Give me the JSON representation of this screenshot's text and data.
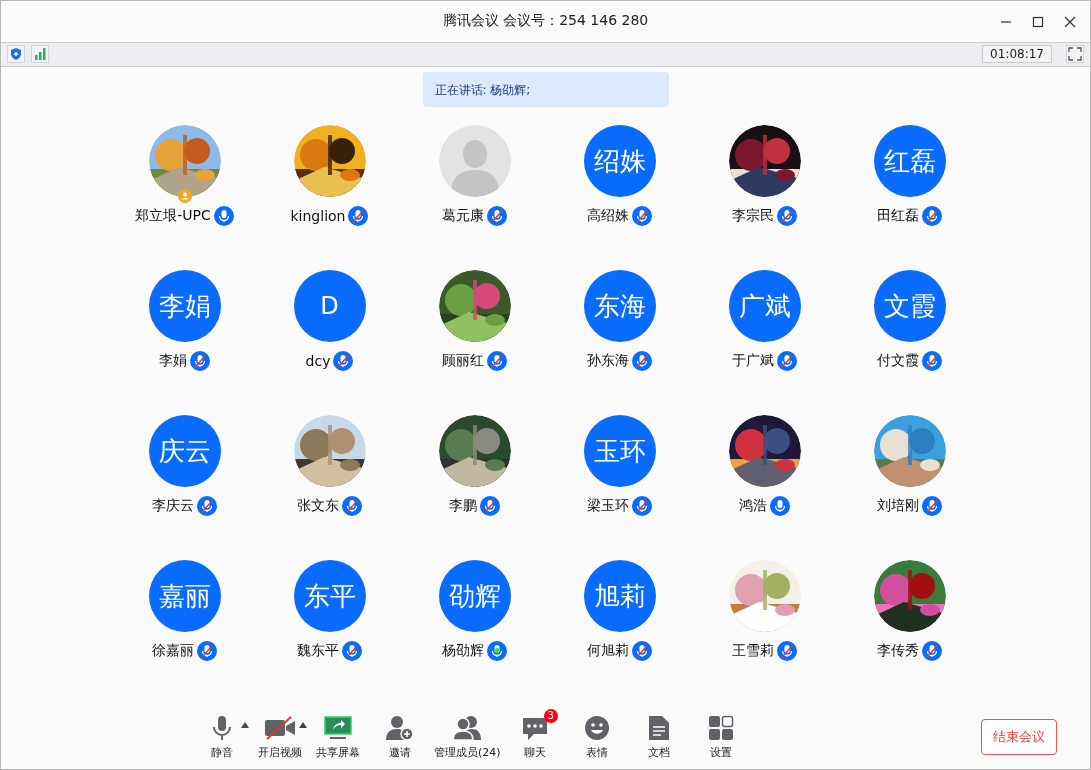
{
  "window": {
    "title": "腾讯会议 会议号：254 146 280"
  },
  "status_bar": {
    "timer": "01:08:17"
  },
  "speaking": "正在讲话: 杨劭辉;",
  "participants": [
    {
      "name": "郑立垠-UPC",
      "muted": false,
      "speaking": false,
      "host": true
    },
    {
      "name": "kinglion",
      "muted": true,
      "speaking": false,
      "host": false
    },
    {
      "name": "葛元康",
      "avatar": {
        "kind": "default"
      },
      "muted": true,
      "speaking": false,
      "host": false
    },
    {
      "name": "高绍姝",
      "avatar": {
        "kind": "initials",
        "text": "绍姝"
      },
      "muted": true,
      "speaking": false,
      "host": false
    },
    {
      "name": "李宗民",
      "muted": true,
      "speaking": false,
      "host": false
    },
    {
      "name": "田红磊",
      "avatar": {
        "kind": "initials",
        "text": "红磊"
      },
      "muted": true,
      "speaking": false,
      "host": false
    },
    {
      "name": "李娟",
      "avatar": {
        "kind": "initials",
        "text": "李娟"
      },
      "muted": true,
      "speaking": false,
      "host": false
    },
    {
      "name": "dcy",
      "avatar": {
        "kind": "initials",
        "text": "D"
      },
      "muted": true,
      "speaking": false,
      "host": false
    },
    {
      "name": "顾丽红",
      "muted": true,
      "speaking": false,
      "host": false
    },
    {
      "name": "孙东海",
      "avatar": {
        "kind": "initials",
        "text": "东海"
      },
      "muted": true,
      "speaking": false,
      "host": false
    },
    {
      "name": "于广斌",
      "avatar": {
        "kind": "initials",
        "text": "广斌"
      },
      "muted": true,
      "speaking": false,
      "host": false
    },
    {
      "name": "付文霞",
      "avatar": {
        "kind": "initials",
        "text": "文霞"
      },
      "muted": true,
      "speaking": false,
      "host": false
    },
    {
      "name": "李庆云",
      "avatar": {
        "kind": "initials",
        "text": "庆云"
      },
      "muted": true,
      "speaking": false,
      "host": false
    },
    {
      "name": "张文东",
      "muted": true,
      "speaking": false,
      "host": false
    },
    {
      "name": "李鹏",
      "muted": true,
      "speaking": false,
      "host": false
    },
    {
      "name": "梁玉环",
      "avatar": {
        "kind": "initials",
        "text": "玉环"
      },
      "muted": true,
      "speaking": false,
      "host": false
    },
    {
      "name": "鸿浩",
      "muted": false,
      "speaking": false,
      "host": false
    },
    {
      "name": "刘培刚",
      "muted": true,
      "speaking": false,
      "host": false
    },
    {
      "name": "徐嘉丽",
      "avatar": {
        "kind": "initials",
        "text": "嘉丽"
      },
      "muted": true,
      "speaking": false,
      "host": false
    },
    {
      "name": "魏东平",
      "avatar": {
        "kind": "initials",
        "text": "东平"
      },
      "muted": true,
      "speaking": false,
      "host": false
    },
    {
      "name": "杨劭辉",
      "avatar": {
        "kind": "initials",
        "text": "劭辉"
      },
      "muted": false,
      "speaking": true,
      "host": false
    },
    {
      "name": "何旭莉",
      "avatar": {
        "kind": "initials",
        "text": "旭莉"
      },
      "muted": true,
      "speaking": false,
      "host": false
    },
    {
      "name": "王雪莉",
      "muted": true,
      "speaking": false,
      "host": false
    },
    {
      "name": "李传秀",
      "muted": true,
      "speaking": false,
      "host": false
    }
  ],
  "toolbar": [
    {
      "kind": "mute",
      "label": "静音",
      "menu": true
    },
    {
      "kind": "video",
      "label": "开启视频",
      "menu": true
    },
    {
      "kind": "share",
      "label": "共享屏幕",
      "menu": false
    },
    {
      "kind": "invite",
      "label": "邀请",
      "menu": false
    },
    {
      "kind": "members",
      "label": "管理成员(24)",
      "menu": false
    },
    {
      "kind": "chat",
      "label": "聊天",
      "menu": false,
      "badge": "3"
    },
    {
      "kind": "emoji",
      "label": "表情",
      "menu": false
    },
    {
      "kind": "docs",
      "label": "文档",
      "menu": false
    },
    {
      "kind": "settings",
      "label": "设置",
      "menu": false
    }
  ],
  "end_button": "结束会议"
}
